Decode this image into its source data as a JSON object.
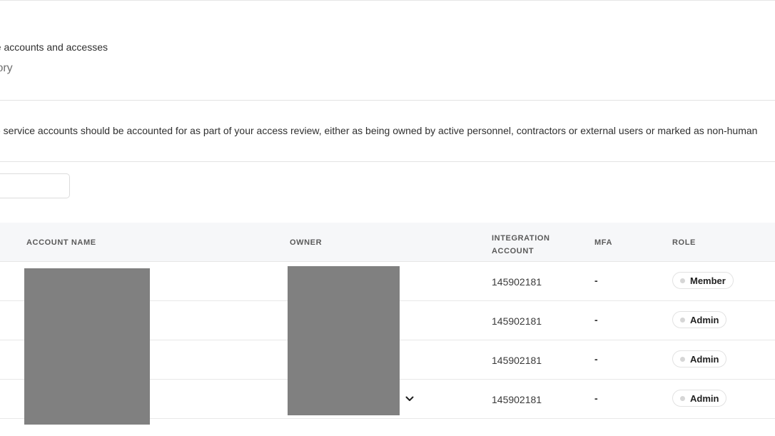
{
  "header": {
    "subtitle": "ge accounts and accesses",
    "history_tab": "story"
  },
  "notice": {
    "text": "e service accounts should be accounted for as part of your access review, either as being owned by active personnel, contractors or external users or marked as non-human"
  },
  "table": {
    "columns": {
      "account_name": "ACCOUNT NAME",
      "owner": "OWNER",
      "integration_account": "INTEGRATION ACCOUNT",
      "integration_line1": "INTEGRATION",
      "integration_line2": "ACCOUNT",
      "mfa": "MFA",
      "role": "ROLE"
    },
    "rows": [
      {
        "integration_account": "145902181",
        "mfa": "-",
        "role": "Member"
      },
      {
        "integration_account": "145902181",
        "mfa": "-",
        "role": "Admin"
      },
      {
        "integration_account": "145902181",
        "mfa": "-",
        "role": "Admin"
      },
      {
        "integration_account": "145902181",
        "mfa": "-",
        "role": "Admin"
      }
    ]
  },
  "icons": {
    "owner_dropdown": "chevron-down-icon",
    "role_status": "status-dot-icon"
  },
  "colors": {
    "header_bg": "#f6f7f9",
    "redaction": "#808080",
    "status_dot": "#d6d6d6"
  }
}
